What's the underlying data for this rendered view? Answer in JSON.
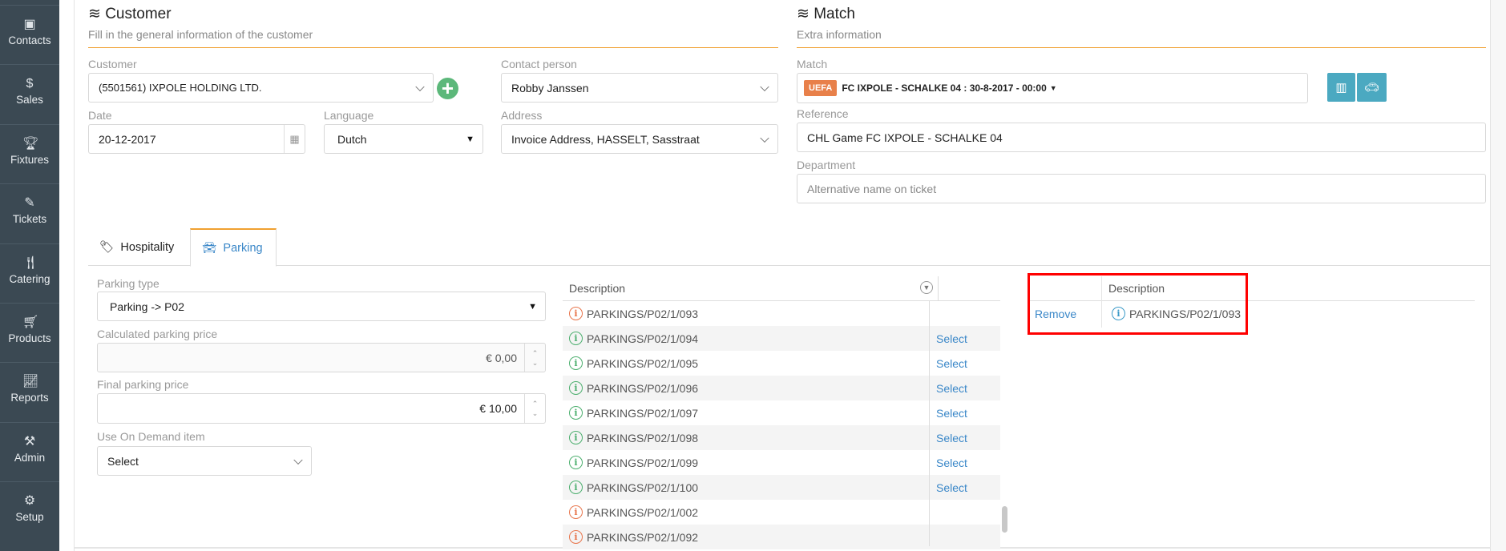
{
  "sidebar": {
    "items": [
      {
        "label": "Contacts",
        "icon": "contacts-icon"
      },
      {
        "label": "Sales",
        "icon": "dollar-icon"
      },
      {
        "label": "Fixtures",
        "icon": "trophy-icon"
      },
      {
        "label": "Tickets",
        "icon": "ticket-icon"
      },
      {
        "label": "Catering",
        "icon": "cutlery-icon"
      },
      {
        "label": "Products",
        "icon": "cart-icon"
      },
      {
        "label": "Reports",
        "icon": "chart-icon"
      },
      {
        "label": "Admin",
        "icon": "tools-icon"
      },
      {
        "label": "Setup",
        "icon": "gears-icon"
      }
    ]
  },
  "customer": {
    "title": "Customer",
    "subtitle": "Fill in the general information of the customer",
    "customer_label": "Customer",
    "customer_value": "(5501561) IXPOLE HOLDING LTD.",
    "date_label": "Date",
    "date_value": "20-12-2017",
    "language_label": "Language",
    "language_value": "Dutch",
    "contact_label": "Contact person",
    "contact_value": "Robby Janssen",
    "address_label": "Address",
    "address_value": "Invoice Address, HASSELT, Sasstraat"
  },
  "match": {
    "title": "Match",
    "subtitle": "Extra information",
    "match_label": "Match",
    "badge": "UEFA",
    "match_value": "FC IXPOLE - SCHALKE 04 : 30-8-2017 - 00:00",
    "reference_label": "Reference",
    "reference_value": "CHL Game FC IXPOLE - SCHALKE 04",
    "department_label": "Department",
    "department_placeholder": "Alternative name on ticket"
  },
  "tabs": [
    {
      "label": "Hospitality",
      "active": false
    },
    {
      "label": "Parking",
      "active": true
    }
  ],
  "parking": {
    "type_label": "Parking type",
    "type_value": "Parking -> P02",
    "calc_label": "Calculated parking price",
    "calc_value": "€ 0,00",
    "final_label": "Final parking price",
    "final_value": "€ 10,00",
    "ondemand_label": "Use On Demand item",
    "ondemand_value": "Select"
  },
  "available": {
    "header": "Description",
    "select_label": "Select",
    "rows": [
      {
        "desc": "PARKINGS/P02/1/093",
        "status": "unavailable",
        "select": false
      },
      {
        "desc": "PARKINGS/P02/1/094",
        "status": "available",
        "select": true
      },
      {
        "desc": "PARKINGS/P02/1/095",
        "status": "available",
        "select": true
      },
      {
        "desc": "PARKINGS/P02/1/096",
        "status": "available",
        "select": true
      },
      {
        "desc": "PARKINGS/P02/1/097",
        "status": "available",
        "select": true
      },
      {
        "desc": "PARKINGS/P02/1/098",
        "status": "available",
        "select": true
      },
      {
        "desc": "PARKINGS/P02/1/099",
        "status": "available",
        "select": true
      },
      {
        "desc": "PARKINGS/P02/1/100",
        "status": "available",
        "select": true
      },
      {
        "desc": "PARKINGS/P02/1/002",
        "status": "unavailable",
        "select": false
      },
      {
        "desc": "PARKINGS/P02/1/092",
        "status": "unavailable",
        "select": false
      }
    ]
  },
  "selected": {
    "header": "Description",
    "rows": [
      {
        "action": "Remove",
        "desc": "PARKINGS/P02/1/093"
      }
    ]
  },
  "colors": {
    "available": "#4caf6e",
    "unavailable": "#e8744a",
    "selected": "#3a9ac8",
    "link": "#3a87c8",
    "highlight": "#ff0000"
  }
}
